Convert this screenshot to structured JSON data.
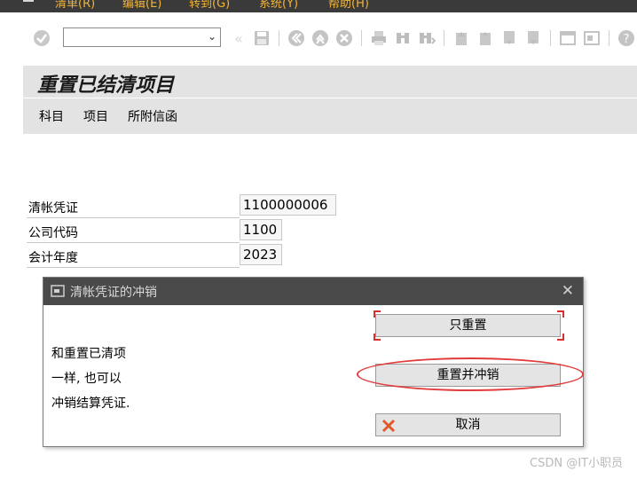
{
  "menubar": {
    "items": [
      "清单(R)",
      "编辑(E)",
      "转到(G)",
      "系统(Y)",
      "帮助(H)"
    ]
  },
  "toolbar": {
    "command_value": "",
    "icons": [
      "enter-icon",
      "save-icon",
      "back-icon",
      "exit-icon",
      "cancel-icon",
      "print-icon",
      "find-icon",
      "find-next-icon",
      "first-page-icon",
      "prev-page-icon",
      "next-page-icon",
      "last-page-icon",
      "new-session-icon",
      "shortcut-icon",
      "help-icon"
    ]
  },
  "screen": {
    "title": "重置已结清项目",
    "app_buttons": [
      "科目",
      "项目",
      "所附信函"
    ]
  },
  "fields": [
    {
      "label": "清帐凭证",
      "value": "1100000006"
    },
    {
      "label": "公司代码",
      "value": "1100"
    },
    {
      "label": "会计年度",
      "value": "2023"
    }
  ],
  "dialog": {
    "title": "清帐凭证的冲销",
    "message_lines": [
      "和重置已清项",
      "一样, 也可以",
      "冲销结算凭证."
    ],
    "buttons": {
      "reset_only": "只重置",
      "reset_and_reverse": "重置并冲销",
      "cancel": "取消"
    }
  },
  "watermark": "CSDN @IT小职员",
  "colors": {
    "menubar_bg": "#3a3a3a",
    "menu_text": "#f2b437",
    "dialog_header": "#4a4a4a",
    "highlight_ellipse": "#e23b3b",
    "cancel_icon": "#e05a2a"
  }
}
